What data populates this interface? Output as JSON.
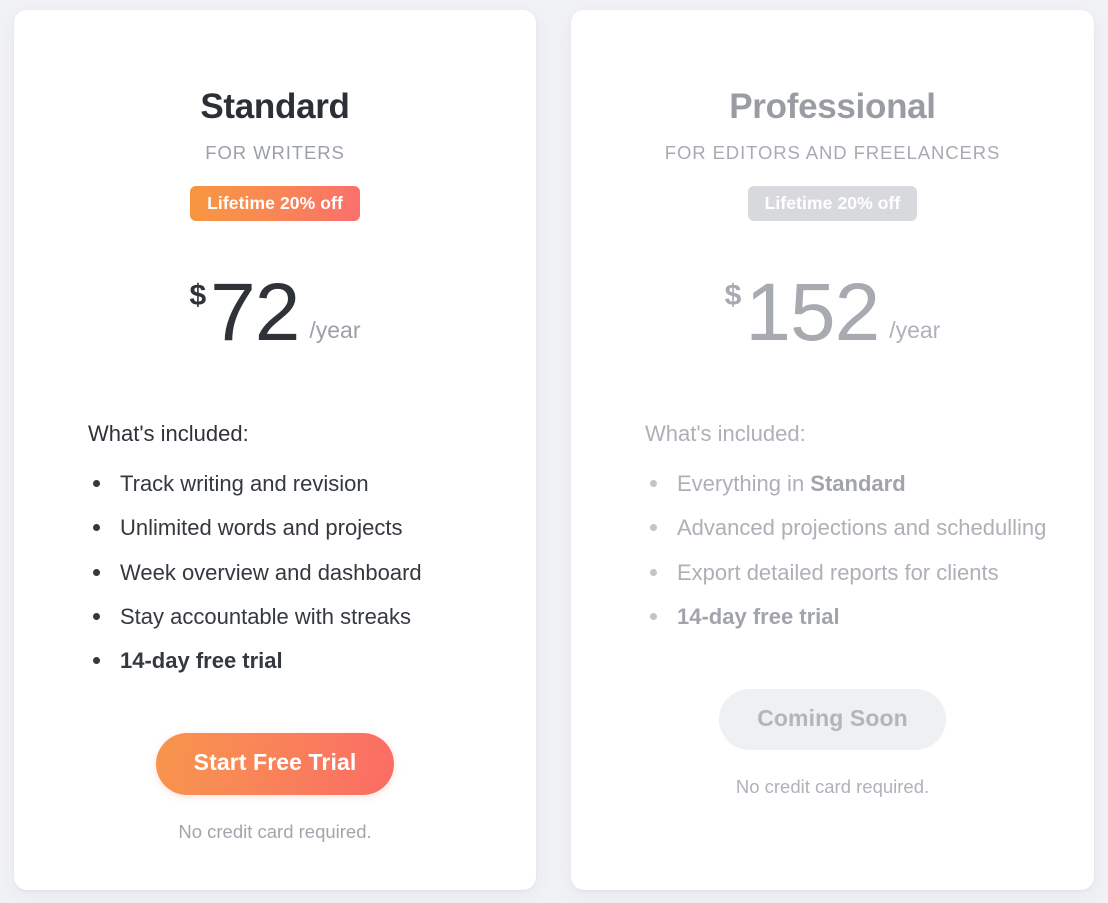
{
  "theme": {
    "page_background": "#f1f2f6",
    "card_background": "#ffffff",
    "accent_gradient_start": "#f7973f",
    "accent_gradient_end": "#fa6c65",
    "muted_gray": "#d8d9dc",
    "text_dark": "#2e3239",
    "text_muted": "#aeb0b7"
  },
  "plans": [
    {
      "id": "standard",
      "name": "Standard",
      "audience": "FOR WRITERS",
      "badge": "Lifetime 20% off",
      "currency": "$",
      "amount": "72",
      "period": "/year",
      "features_title": "What's included:",
      "features": [
        {
          "text": "Track writing and revision",
          "bold": false
        },
        {
          "text": "Unlimited words and projects",
          "bold": false
        },
        {
          "text": "Week overview and dashboard",
          "bold": false
        },
        {
          "text": "Stay accountable with streaks",
          "bold": false
        },
        {
          "text": "14-day free trial",
          "bold": true
        }
      ],
      "cta_label": "Start Free Trial",
      "cta_note": "No credit card required."
    },
    {
      "id": "professional",
      "name": "Professional",
      "audience": "FOR EDITORS AND FREELANCERS",
      "badge": "Lifetime 20% off",
      "currency": "$",
      "amount": "152",
      "period": "/year",
      "features_title": "What's included:",
      "features": [
        {
          "text_before": "Everything in ",
          "emphasis": "Standard",
          "text_after": "",
          "bold": false
        },
        {
          "text": "Advanced projections and schedulling",
          "bold": false
        },
        {
          "text": "Export detailed reports for clients",
          "bold": false
        },
        {
          "text": "14-day free trial",
          "bold": true
        }
      ],
      "cta_label": "Coming Soon",
      "cta_note": "No credit card required."
    }
  ]
}
